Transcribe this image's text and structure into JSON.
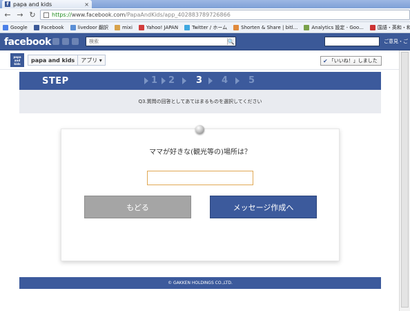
{
  "browser": {
    "tab_title": "papa and kids",
    "tab_favicon": "f",
    "tab_close": "×",
    "url_secure": "https://",
    "url_host": "www.facebook.com",
    "url_path": "/PapaAndKids/app_402883789726866"
  },
  "bookmarks": [
    {
      "label": "Google",
      "icon": "google-icon",
      "color": "#4a7fe8"
    },
    {
      "label": "Facebook",
      "icon": "facebook-icon",
      "color": "#3b5998"
    },
    {
      "label": "livedoor 翻訳",
      "icon": "livedoor-icon",
      "color": "#5a8fd6"
    },
    {
      "label": "mixi",
      "icon": "mixi-icon",
      "color": "#d8a24a"
    },
    {
      "label": "Yahoo! JAPAN",
      "icon": "yahoo-icon",
      "color": "#d23c3c"
    },
    {
      "label": "Twitter / ホーム",
      "icon": "twitter-icon",
      "color": "#3fa8e0"
    },
    {
      "label": "Shorten & Share | bitl...",
      "icon": "bitly-icon",
      "color": "#e08a3c"
    },
    {
      "label": "Analytics 設定 - Goo...",
      "icon": "analytics-icon",
      "color": "#7aa14a"
    },
    {
      "label": "国語・英和・和英・類...",
      "icon": "dictionary-icon",
      "color": "#cc3333"
    }
  ],
  "facebook": {
    "logo": "facebook",
    "search_placeholder": "検索",
    "search_icon": "🔍",
    "right_text": "ご意見・ご"
  },
  "app": {
    "logo_lines": [
      "papa",
      "and",
      "kids"
    ],
    "name": "papa and kids",
    "apps_label": "アプリ ▾",
    "like_check": "✔",
    "like_label": "「いいね！」しました"
  },
  "steps": {
    "label": "STEP",
    "numbers": [
      "1",
      "2",
      "3",
      "4",
      "5"
    ],
    "current": 3,
    "instruction": "Q3.質問の回答としてあてはまるものを選択してください"
  },
  "question": {
    "text": "ママが好きな(観光等の)場所は？",
    "answer_value": "",
    "back_label": "もどる",
    "next_label": "メッセージ作成へ"
  },
  "footer": {
    "copyright": "© GAKKEN HOLDINGS CO.,LTD."
  }
}
